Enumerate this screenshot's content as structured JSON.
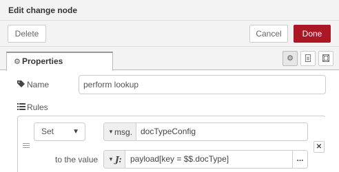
{
  "dialog": {
    "title": "Edit change node"
  },
  "toolbar": {
    "delete_label": "Delete",
    "cancel_label": "Cancel",
    "done_label": "Done"
  },
  "tabs": {
    "properties_label": "Properties"
  },
  "form": {
    "name_label": "Name",
    "name_value": "perform lookup",
    "rules_label": "Rules"
  },
  "rule": {
    "action": "Set",
    "target_type": "msg.",
    "target_value": "docTypeConfig",
    "to_value_label": "to the value",
    "value_type": "J:",
    "value": "payload[key = $$.docType]",
    "expand_label": "..."
  },
  "icons": {
    "gear": "gear-icon",
    "description": "file-text-icon",
    "appearance": "layout-icon",
    "tag": "tag-icon",
    "list": "list-icon",
    "drag": "drag-handle-icon",
    "remove": "close-icon"
  },
  "colors": {
    "accent": "#ad1625"
  }
}
